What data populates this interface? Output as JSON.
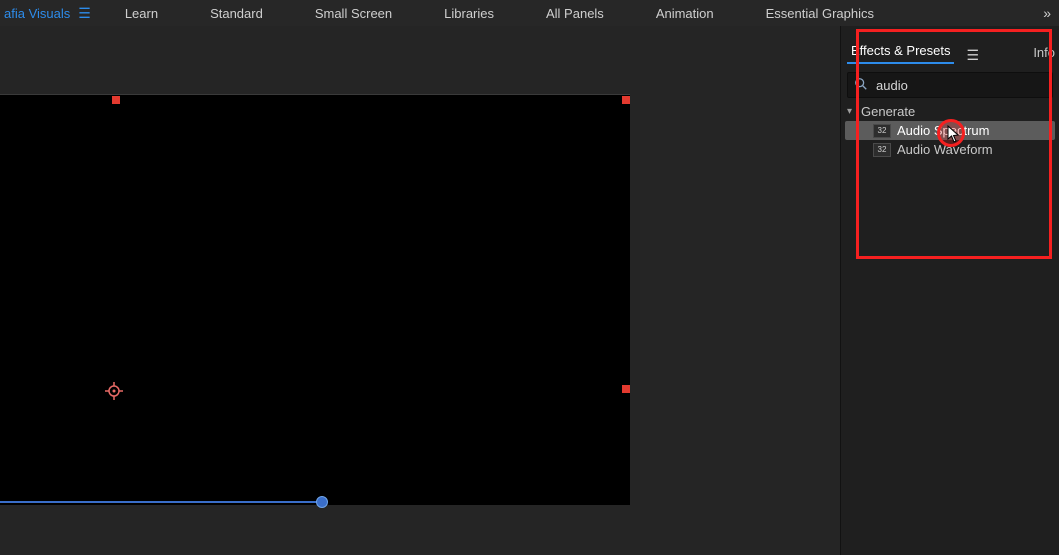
{
  "project": {
    "name_fragment": "afia Visuals"
  },
  "workspaces": [
    "Learn",
    "Standard",
    "Small Screen",
    "Libraries",
    "All Panels",
    "Animation",
    "Essential Graphics"
  ],
  "panel": {
    "tabs": {
      "active": "Effects & Presets",
      "secondary_truncated": "Info"
    },
    "search": {
      "value": "audio",
      "placeholder": ""
    },
    "results": {
      "category": "Generate",
      "items": [
        {
          "label": "Audio Spectrum",
          "badge": "32",
          "selected": true
        },
        {
          "label": "Audio Waveform",
          "badge": "32",
          "selected": false
        }
      ]
    }
  }
}
